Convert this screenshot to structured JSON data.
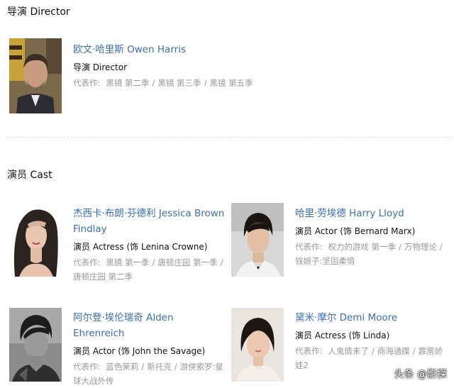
{
  "director_section": {
    "title": "导演 Director",
    "person": {
      "name": "欧文·哈里斯 Owen Harris",
      "role": "导演 Director",
      "works_label": "代表作:",
      "works": [
        "黑镜 第二季",
        "黑镜 第三季",
        "黑镜 第五季"
      ]
    }
  },
  "cast_section": {
    "title": "演员 Cast",
    "people": [
      {
        "name": "杰西卡·布朗·芬德利 Jessica Brown Findlay",
        "role": "演员 Actress (饰 Lenina Crowne)",
        "works_label": "代表作:",
        "works": [
          "黑镜 第一季",
          "唐顿庄园 第一季",
          "唐顿庄园 第二季"
        ]
      },
      {
        "name": "哈里·劳埃德 Harry Lloyd",
        "role": "演员 Actor (饰 Bernard Marx)",
        "works_label": "代表作:",
        "works": [
          "权力的游戏 第一季",
          "万物理论",
          "铁娘子:坚固柔情"
        ]
      },
      {
        "name": "阿尔登·埃伦瑞奇 Alden Ehrenreich",
        "role": "演员 Actor (饰 John the Savage)",
        "works_label": "代表作:",
        "works": [
          "蓝色茉莉",
          "斯托克",
          "游侠索罗:星球大战外传"
        ]
      },
      {
        "name": "黛米·摩尔 Demi Moore",
        "role": "演员 Actress (饰 Linda)",
        "works_label": "代表作:",
        "works": [
          "人鬼情未了",
          "商海通牒",
          "霹雳娇娃2"
        ]
      }
    ]
  },
  "watermark": "头条 @影探"
}
